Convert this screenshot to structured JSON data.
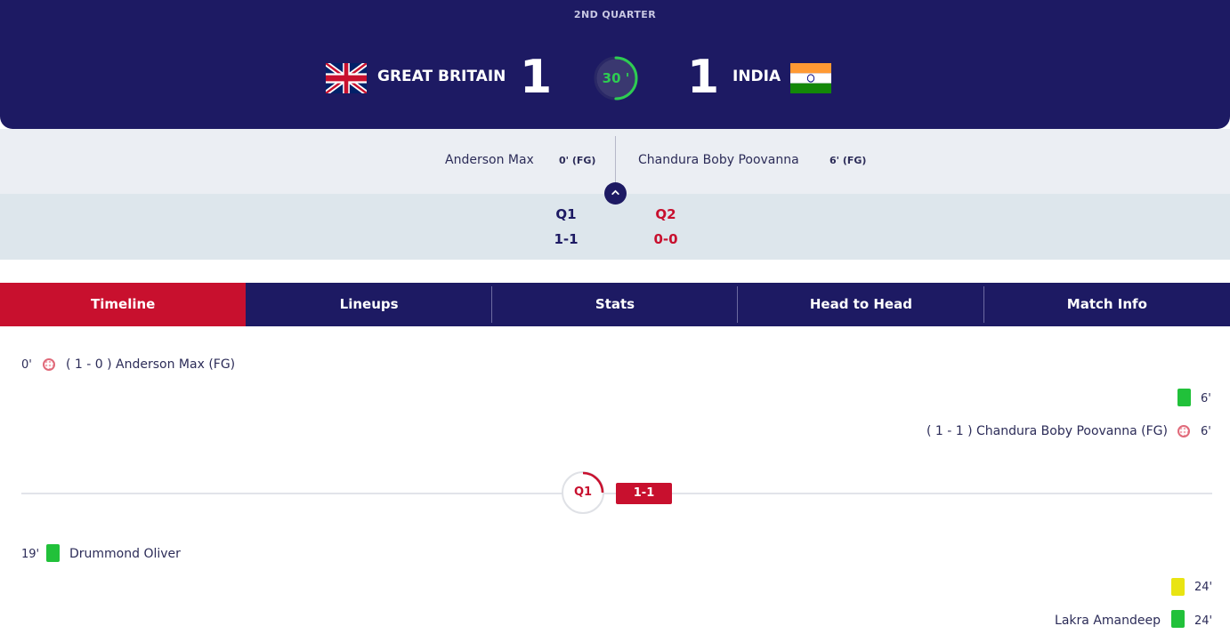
{
  "match": {
    "period": "2ND QUARTER",
    "clock": "30 '",
    "clock_progress": 0.5,
    "home": {
      "name": "GREAT BRITAIN",
      "score": "1"
    },
    "away": {
      "name": "INDIA",
      "score": "1"
    }
  },
  "scorers": {
    "home": {
      "name": "Anderson Max",
      "minute": "0' (FG)"
    },
    "away": {
      "name": "Chandura Boby Poovanna",
      "minute": "6' (FG)"
    }
  },
  "quarters": [
    {
      "label": "Q1",
      "score": "1-1"
    },
    {
      "label": "Q2",
      "score": "0-0"
    }
  ],
  "tabs": [
    "Timeline",
    "Lineups",
    "Stats",
    "Head to Head",
    "Match Info"
  ],
  "timeline": {
    "e1": {
      "minute": "0'",
      "text": "( 1 - 0 ) Anderson Max (FG)"
    },
    "e2": {
      "minute": "6'"
    },
    "e3": {
      "minute": "6'",
      "text": "( 1 - 1 ) Chandura Boby Poovanna (FG)"
    },
    "quarter_marker": {
      "label": "Q1",
      "score": "1-1"
    },
    "e4": {
      "minute": "19'",
      "text": "Drummond Oliver"
    },
    "e5": {
      "minute": "24'"
    },
    "e6": {
      "minute": "24'",
      "text": "Lakra Amandeep"
    }
  },
  "colors": {
    "navy": "#1d1a63",
    "red": "#c8102e",
    "green_card": "#21c13a",
    "yellow_card": "#e9e412",
    "clock_green": "#2ecc52"
  }
}
